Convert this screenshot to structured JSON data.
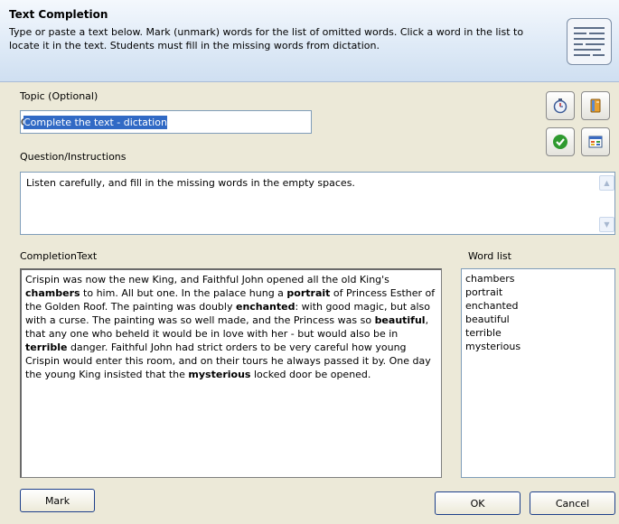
{
  "header": {
    "title": "Text Completion",
    "description": "Type or paste a text below. Mark (unmark) words for the list of omitted words. Click a word in the list to locate it in the text. Students must fill in the missing words from dictation.",
    "icon": "document-lines-icon"
  },
  "topic": {
    "label": "Topic (Optional)",
    "value": "Complete the text - dictation"
  },
  "question": {
    "label": "Question/Instructions",
    "value": "Listen carefully, and fill in the missing words in the empty spaces."
  },
  "completion": {
    "label": "CompletionText",
    "segments": [
      {
        "text": "Crispin was now the new King, and Faithful John opened all the old King's ",
        "bold": false
      },
      {
        "text": "chambers",
        "bold": true
      },
      {
        "text": " to him. All but one. In the palace hung a ",
        "bold": false
      },
      {
        "text": "portrait",
        "bold": true
      },
      {
        "text": " of Princess Esther of the Golden Roof. The painting was doubly ",
        "bold": false
      },
      {
        "text": "enchanted",
        "bold": true
      },
      {
        "text": ": with good magic, but also with a curse. The painting was so well made, and the Princess was so ",
        "bold": false
      },
      {
        "text": "beautiful",
        "bold": true
      },
      {
        "text": ", that any one who beheld it would be in love with her - but would also be in ",
        "bold": false
      },
      {
        "text": "terrible",
        "bold": true
      },
      {
        "text": " danger. Faithful John had strict orders to be very careful how young Crispin would enter this room, and on their tours he always passed it by. One day the young King insisted that the ",
        "bold": false
      },
      {
        "text": "mysterious",
        "bold": true
      },
      {
        "text": " locked door be opened.",
        "bold": false
      }
    ]
  },
  "wordlist": {
    "label": "Word list",
    "items": [
      "chambers",
      "portrait",
      "enchanted",
      "beautiful",
      "terrible",
      "mysterious"
    ]
  },
  "tools": {
    "timer_icon": "stopwatch-icon",
    "book_icon": "book-icon",
    "check_icon": "green-check-icon",
    "grid_icon": "table-grid-icon"
  },
  "buttons": {
    "mark": "Mark",
    "ok": "OK",
    "cancel": "Cancel"
  },
  "colors": {
    "selection": "#316ac5",
    "header_bg": "#dde9f6",
    "window_bg": "#ece9d8",
    "border_blue": "#7f9db9"
  }
}
